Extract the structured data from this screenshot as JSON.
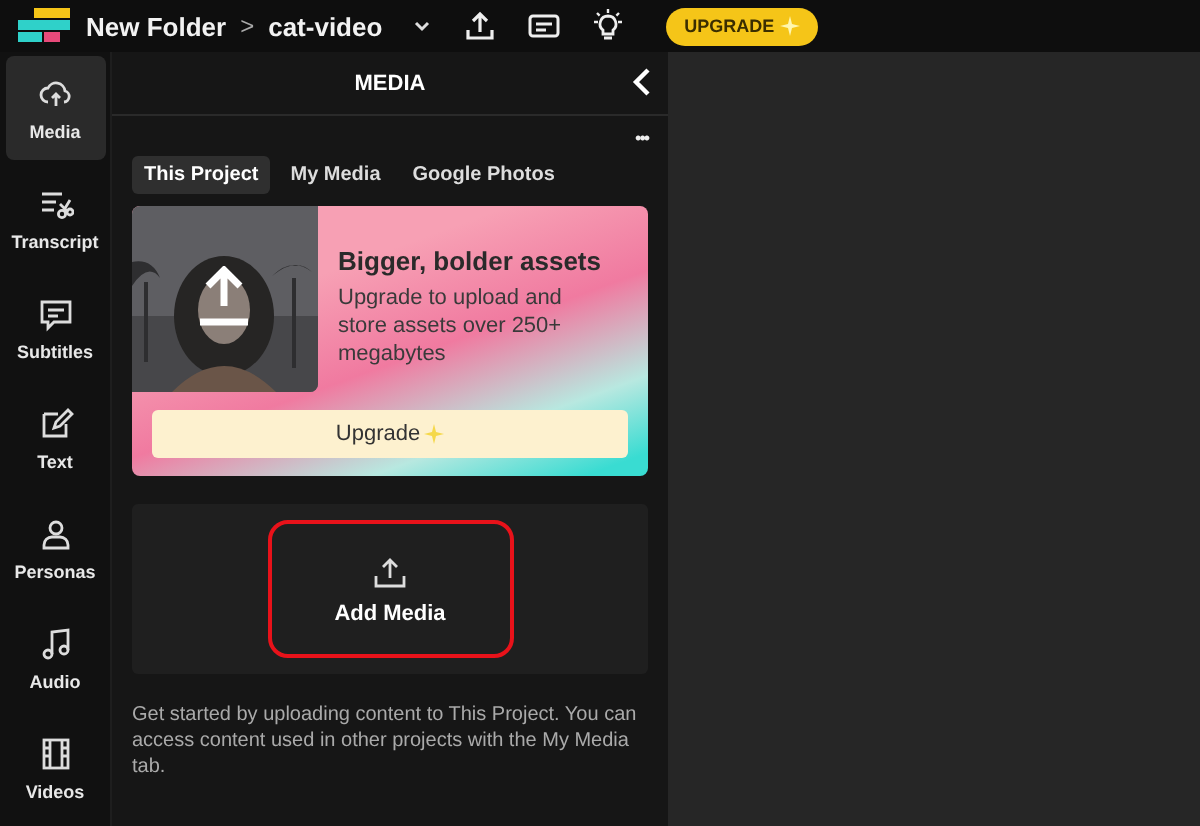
{
  "topbar": {
    "breadcrumb": [
      {
        "label": "New Folder"
      },
      {
        "label": "cat-video"
      }
    ],
    "separator": ">",
    "upgrade": {
      "label": "UPGRADE"
    }
  },
  "sidebar": {
    "items": [
      {
        "kind": "media",
        "label": "Media",
        "selected": true
      },
      {
        "kind": "transcript",
        "label": "Transcript",
        "selected": false
      },
      {
        "kind": "subtitles",
        "label": "Subtitles",
        "selected": false
      },
      {
        "kind": "text",
        "label": "Text",
        "selected": false
      },
      {
        "kind": "personas",
        "label": "Personas",
        "selected": false
      },
      {
        "kind": "audio",
        "label": "Audio",
        "selected": false
      },
      {
        "kind": "videos",
        "label": "Videos",
        "selected": false
      }
    ]
  },
  "panel": {
    "title": "MEDIA",
    "more": "•••",
    "tabs": [
      {
        "label": "This Project",
        "selected": true
      },
      {
        "label": "My Media",
        "selected": false
      },
      {
        "label": "Google Photos",
        "selected": false
      }
    ],
    "promo": {
      "title": "Bigger, bolder assets",
      "text": "Upgrade to upload and store assets over 250+ megabytes",
      "button": "Upgrade"
    },
    "add_media": {
      "label": "Add Media",
      "highlighted": true
    },
    "help": "Get started by uploading content to This Project. You can access content used in other projects with the My Media tab."
  }
}
